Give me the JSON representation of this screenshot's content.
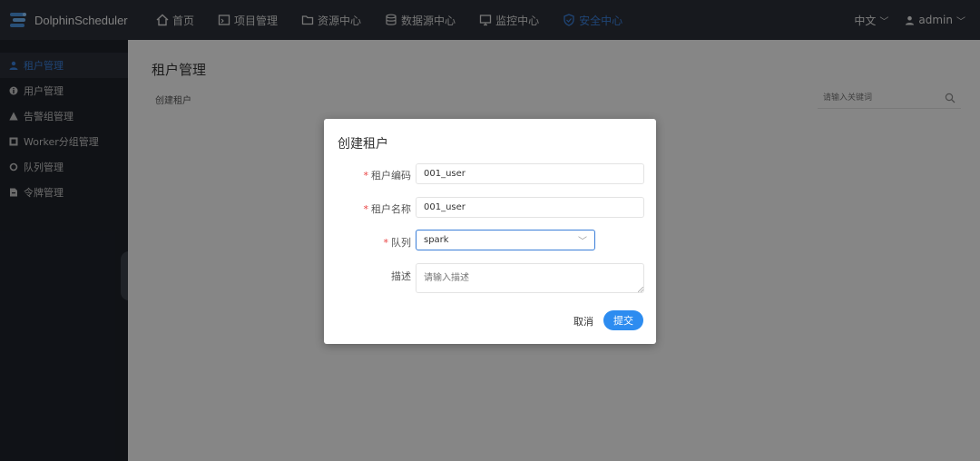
{
  "app": {
    "name": "DolphinScheduler"
  },
  "nav": {
    "items": [
      {
        "label": "首页",
        "icon": "home-icon"
      },
      {
        "label": "项目管理",
        "icon": "project-icon"
      },
      {
        "label": "资源中心",
        "icon": "folder-icon"
      },
      {
        "label": "数据源中心",
        "icon": "database-icon"
      },
      {
        "label": "监控中心",
        "icon": "monitor-icon"
      },
      {
        "label": "安全中心",
        "icon": "shield-icon"
      }
    ],
    "active_index": 5,
    "language": "中文",
    "user": "admin"
  },
  "sidebar": {
    "items": [
      {
        "label": "租户管理",
        "icon": "user-icon"
      },
      {
        "label": "用户管理",
        "icon": "info-icon"
      },
      {
        "label": "告警组管理",
        "icon": "warning-icon"
      },
      {
        "label": "Worker分组管理",
        "icon": "group-icon"
      },
      {
        "label": "队列管理",
        "icon": "queue-icon"
      },
      {
        "label": "令牌管理",
        "icon": "token-icon"
      }
    ],
    "active_index": 0
  },
  "page": {
    "title": "租户管理",
    "create_label": "创建租户",
    "search_placeholder": "请输入关键词"
  },
  "modal": {
    "title": "创建租户",
    "fields": {
      "tenant_code": {
        "label": "租户编码",
        "value": "001_user"
      },
      "tenant_name": {
        "label": "租户名称",
        "value": "001_user"
      },
      "queue": {
        "label": "队列",
        "value": "spark"
      },
      "description": {
        "label": "描述",
        "placeholder": "请输入描述"
      }
    },
    "required_mark": "*",
    "cancel_label": "取消",
    "submit_label": "提交"
  },
  "colors": {
    "topbar": "#2b2f38",
    "sidebar": "#1e2129",
    "accent": "#2d8cf0",
    "active_nav": "#3a7ed8"
  }
}
